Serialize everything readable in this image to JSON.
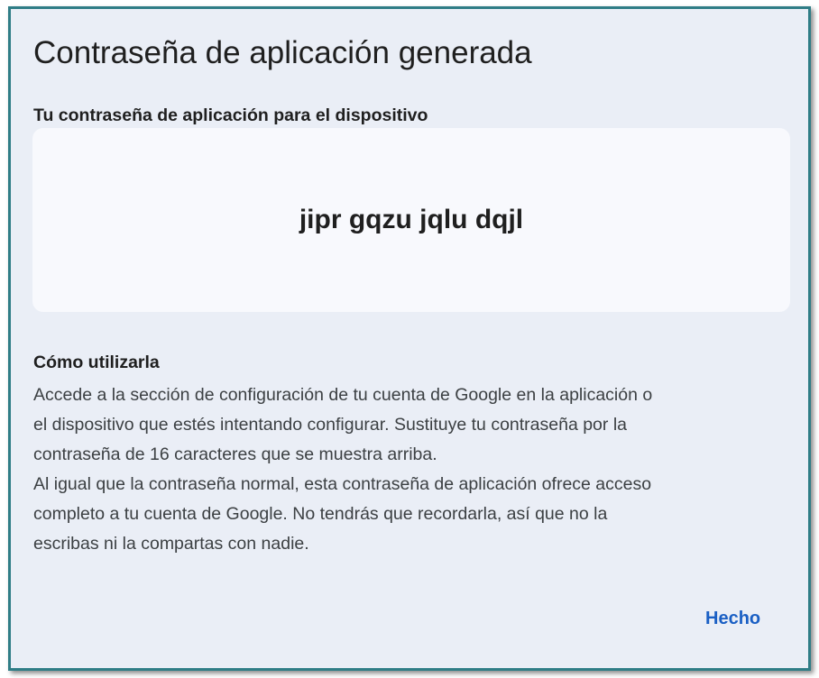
{
  "dialog": {
    "title": "Contraseña de aplicación generada",
    "password_label": "Tu contraseña de aplicación para el dispositivo",
    "password_value": "jipr gqzu jqlu dqjl",
    "howto_heading": "Cómo utilizarla",
    "howto_lines": [
      "Accede a la sección de configuración de tu cuenta de Google en la aplicación o",
      "el dispositivo que estés intentando configurar. Sustituye tu contraseña por la",
      "contraseña de 16 caracteres que se muestra arriba.",
      "Al igual que la contraseña normal, esta contraseña de aplicación ofrece acceso",
      "completo a tu cuenta de Google. No tendrás que recordarla, así que no la",
      "escribas ni la compartas con nadie."
    ],
    "done_label": "Hecho"
  },
  "colors": {
    "frame_border": "#2f7d86",
    "dialog_background": "#eaeef6",
    "password_box_background": "#f8f9fd",
    "link_blue": "#1a5fc4"
  }
}
